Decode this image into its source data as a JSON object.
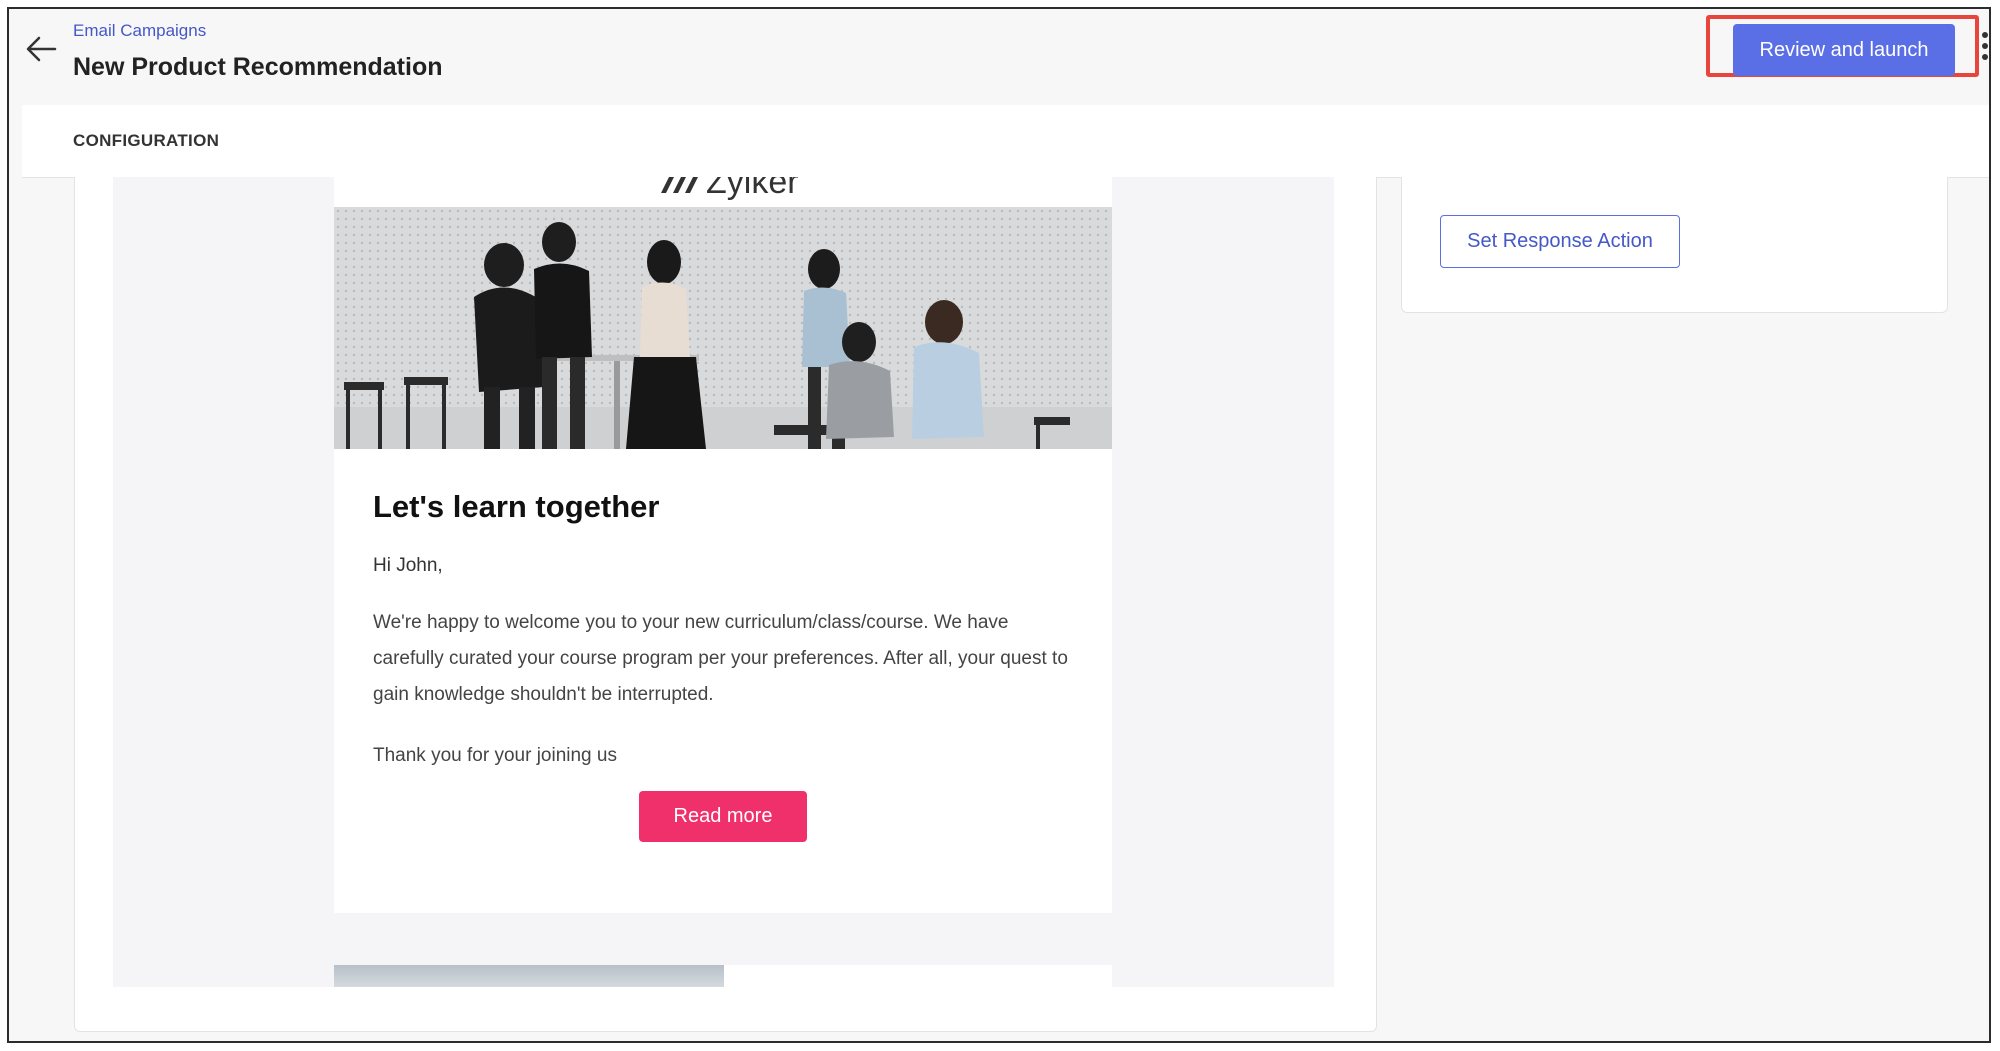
{
  "header": {
    "breadcrumb": "Email Campaigns",
    "title": "New Product Recommendation",
    "primary_button": "Review and launch",
    "back_icon": "arrow-left-icon",
    "more_icon": "more-vertical-icon"
  },
  "tabs": {
    "active": "CONFIGURATION"
  },
  "email_preview": {
    "logo_text": "Zylker",
    "heading": "Let's learn together",
    "greeting": "Hi John,",
    "body": "We're happy to welcome you to your new curriculum/class/course. We have carefully curated your course program per your preferences. After all, your quest to gain knowledge shouldn't be interrupted.",
    "closing": "Thank you for your joining us",
    "cta": "Read more"
  },
  "side_panel": {
    "action_button": "Set Response Action"
  },
  "colors": {
    "primary": "#5a6ee6",
    "link": "#4458c7",
    "cta": "#f0306a",
    "highlight": "#e8453c"
  }
}
